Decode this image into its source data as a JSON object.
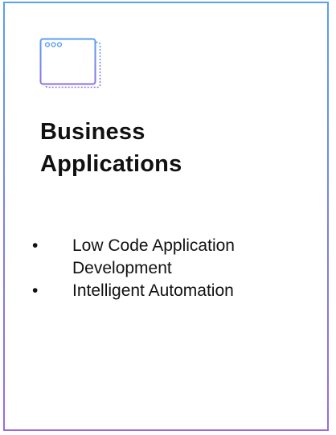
{
  "card": {
    "icon": "application-window-icon",
    "title_line1": "Business",
    "title_line2": "Applications",
    "bullets": [
      {
        "line1": "Low Code Application",
        "line2": "Development"
      },
      {
        "line1": "Intelligent Automation"
      }
    ],
    "colors": {
      "border_top": "#5aa0f0",
      "border_bottom": "#9a6be0",
      "icon_stroke": "#6f86e8",
      "text": "#111111"
    }
  }
}
